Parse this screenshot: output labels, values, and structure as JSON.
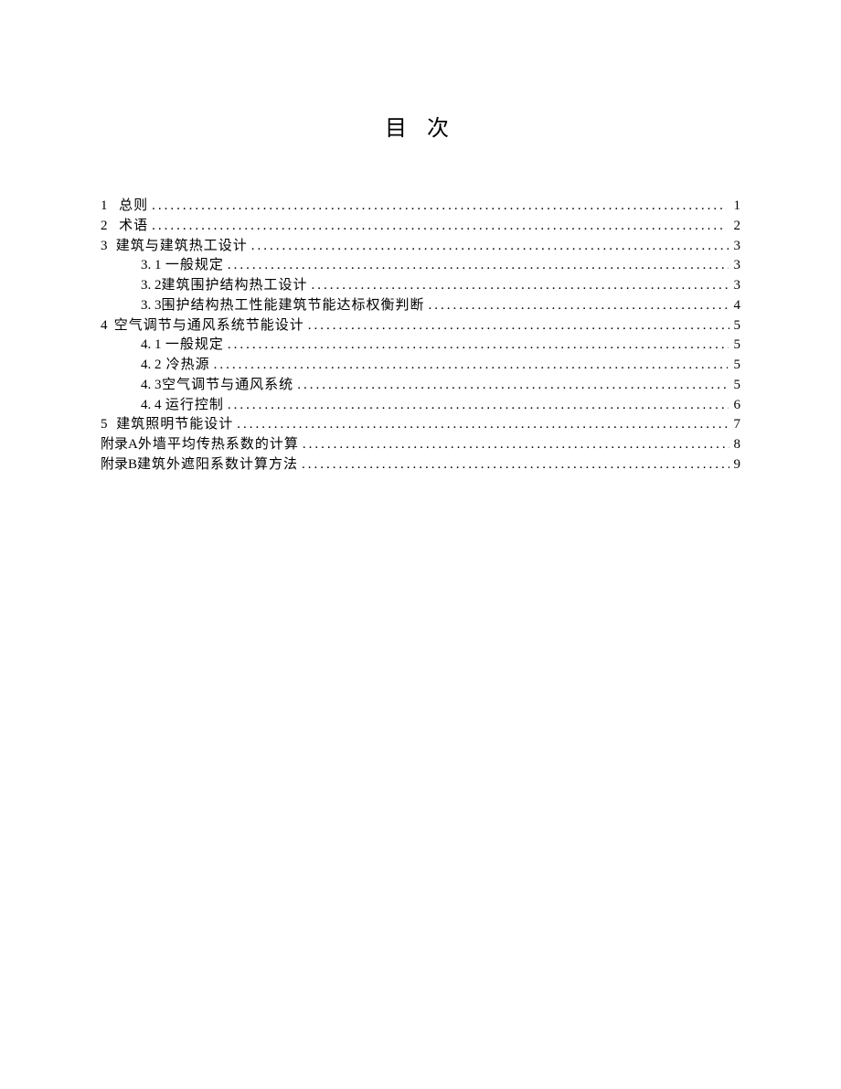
{
  "title": "目 次",
  "toc": [
    {
      "type": "chapter",
      "num": "1",
      "label": "总则",
      "page": "1"
    },
    {
      "type": "chapter",
      "num": "2",
      "label": "术语",
      "page": "2"
    },
    {
      "type": "chapter",
      "num": "3",
      "label": "建筑与建筑热工设计",
      "page": "3"
    },
    {
      "type": "section",
      "num": "3. 1",
      "label": "一般规定",
      "page": "3"
    },
    {
      "type": "section",
      "num": "3. 2",
      "label": "建筑围护结构热工设计",
      "page": "3"
    },
    {
      "type": "section",
      "num": "3. 3",
      "label": "围护结构热工性能建筑节能达标权衡判断",
      "page": "4"
    },
    {
      "type": "chapter",
      "num": "4",
      "label": "空气调节与通风系统节能设计",
      "page": "5"
    },
    {
      "type": "section",
      "num": "4. 1",
      "label": "一般规定",
      "page": "5"
    },
    {
      "type": "section",
      "num": "4. 2",
      "label": "冷热源",
      "page": "5"
    },
    {
      "type": "section",
      "num": "4. 3",
      "label": "空气调节与通风系统",
      "page": "5"
    },
    {
      "type": "section",
      "num": "4. 4",
      "label": "运行控制",
      "page": "6"
    },
    {
      "type": "chapter",
      "num": "5",
      "label": "建筑照明节能设计",
      "page": "7"
    },
    {
      "type": "appendix",
      "num": "附录A",
      "label": "外墙平均传热系数的计算",
      "page": "8"
    },
    {
      "type": "appendix",
      "num": "附录B",
      "label": "建筑外遮阳系数计算方法",
      "page": "9"
    }
  ]
}
